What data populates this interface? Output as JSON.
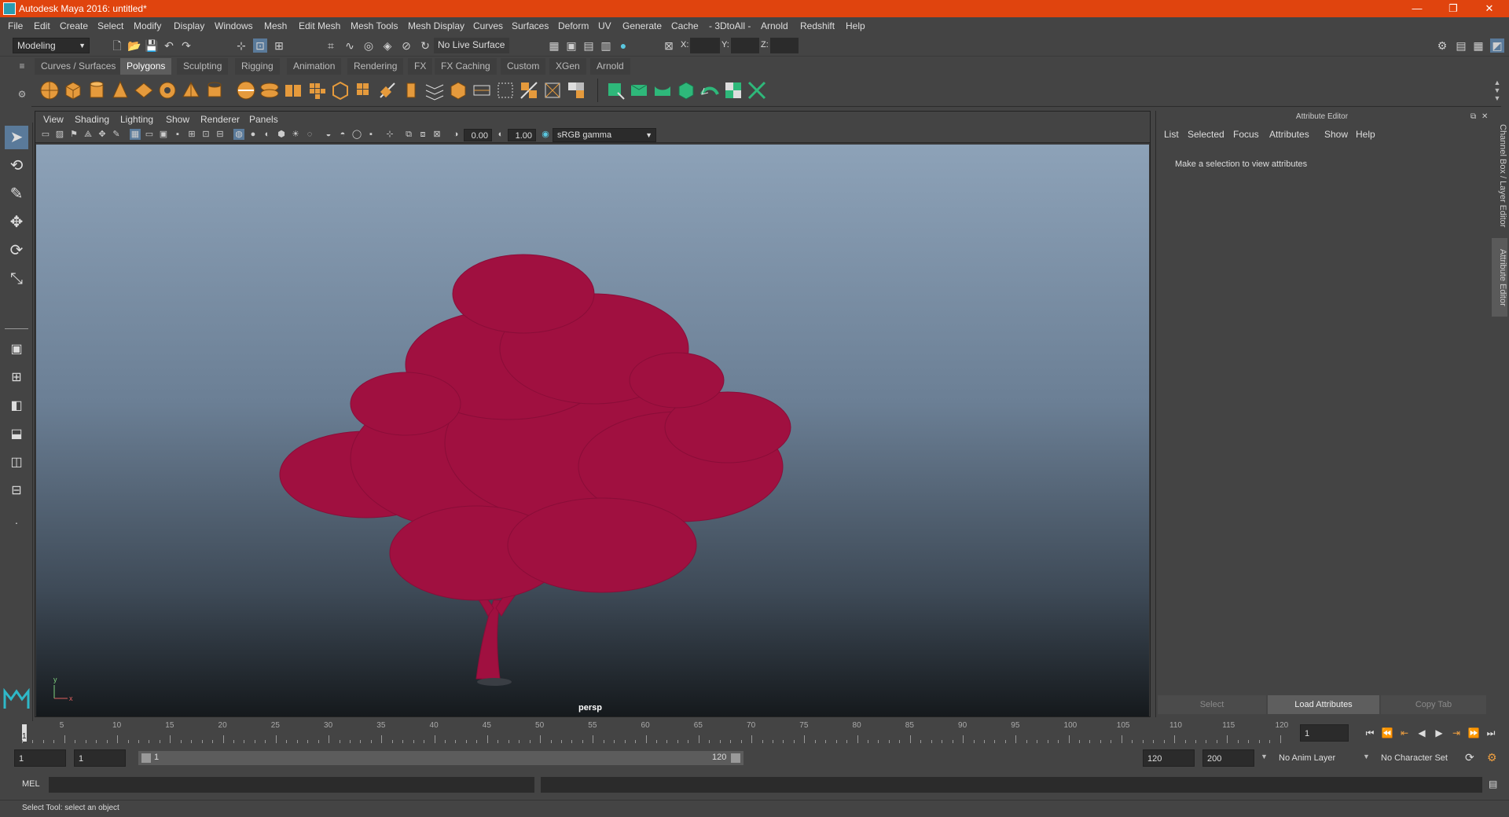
{
  "window": {
    "title": "Autodesk Maya 2016: untitled*",
    "minimize": "—",
    "restore": "❐",
    "close": "✕"
  },
  "menu": [
    "File",
    "Edit",
    "Create",
    "Select",
    "Modify",
    "Display",
    "Windows",
    "Mesh",
    "Edit Mesh",
    "Mesh Tools",
    "Mesh Display",
    "Curves",
    "Surfaces",
    "Deform",
    "UV",
    "Generate",
    "Cache",
    "- 3DtoAll -",
    "Arnold",
    "Redshift",
    "Help"
  ],
  "status_line": {
    "mode": "Modeling",
    "live_surface": "No Live Surface",
    "x_label": "X:",
    "y_label": "Y:",
    "z_label": "Z:"
  },
  "shelf_tabs": [
    "Curves / Surfaces",
    "Polygons",
    "Sculpting",
    "Rigging",
    "Animation",
    "Rendering",
    "FX",
    "FX Caching",
    "Custom",
    "XGen",
    "Arnold"
  ],
  "shelf_active": "Polygons",
  "viewport": {
    "menu": [
      "View",
      "Shading",
      "Lighting",
      "Show",
      "Renderer",
      "Panels"
    ],
    "exposure": "0.00",
    "gamma": "1.00",
    "color_space": "sRGB gamma",
    "camera_label": "persp",
    "tree_color": "#a01040",
    "axis_y": "y",
    "axis_x": "x"
  },
  "attribute_editor": {
    "header": "Attribute Editor",
    "menu": [
      "List",
      "Selected",
      "Focus",
      "Attributes",
      "Show",
      "Help"
    ],
    "message": "Make a selection to view attributes",
    "buttons": {
      "select": "Select",
      "load": "Load Attributes",
      "copy": "Copy Tab"
    }
  },
  "side_tabs": {
    "channel_box": "Channel Box / Layer Editor",
    "attribute_editor": "Attribute Editor"
  },
  "time_slider": {
    "labels": [
      "5",
      "10",
      "15",
      "20",
      "25",
      "30",
      "35",
      "40",
      "45",
      "50",
      "55",
      "60",
      "65",
      "70",
      "75",
      "80",
      "85",
      "90",
      "95",
      "100",
      "105",
      "110",
      "115",
      "120"
    ],
    "current_marker": "1",
    "current_frame": "1"
  },
  "range": {
    "start": "1",
    "range_start": "1",
    "slider_start": "1",
    "slider_end": "120",
    "range_end": "120",
    "end": "200",
    "anim_layer": "No Anim Layer",
    "character_set": "No Character Set"
  },
  "command_line": {
    "label": "MEL"
  },
  "help_line": "Select Tool: select an object"
}
